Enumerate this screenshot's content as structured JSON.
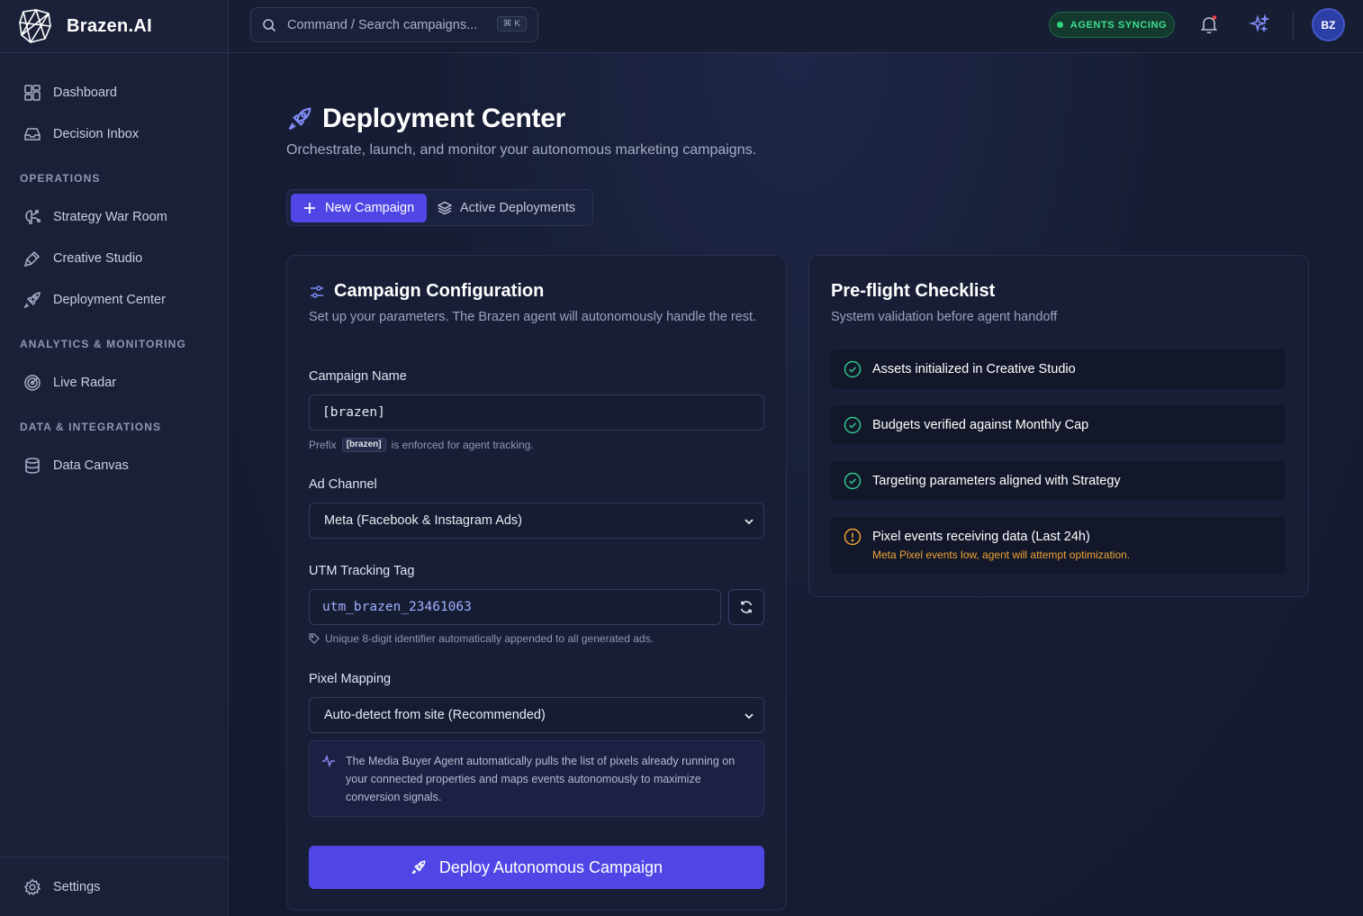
{
  "app": {
    "name": "Brazen.AI"
  },
  "sidebar": {
    "top_items": [
      {
        "label": "Dashboard",
        "icon": "dashboard-icon"
      },
      {
        "label": "Decision Inbox",
        "icon": "inbox-icon"
      }
    ],
    "sections": [
      {
        "title": "OPERATIONS",
        "items": [
          {
            "label": "Strategy War Room",
            "icon": "brain-icon"
          },
          {
            "label": "Creative Studio",
            "icon": "brush-icon"
          },
          {
            "label": "Deployment Center",
            "icon": "rocket-icon"
          }
        ]
      },
      {
        "title": "ANALYTICS & MONITORING",
        "items": [
          {
            "label": "Live Radar",
            "icon": "radar-icon"
          }
        ]
      },
      {
        "title": "DATA & INTEGRATIONS",
        "items": [
          {
            "label": "Data Canvas",
            "icon": "database-icon"
          }
        ]
      }
    ],
    "settings_label": "Settings"
  },
  "topbar": {
    "search_placeholder": "Command / Search campaigns...",
    "shortcut": "⌘ K",
    "status": "AGENTS SYNCING",
    "avatar_initials": "BZ"
  },
  "page": {
    "title": "Deployment Center",
    "subtitle": "Orchestrate, launch, and monitor your autonomous marketing campaigns.",
    "tabs": [
      {
        "label": "New Campaign",
        "active": true
      },
      {
        "label": "Active Deployments",
        "active": false
      }
    ]
  },
  "config": {
    "title": "Campaign Configuration",
    "subtitle": "Set up your parameters. The Brazen agent will autonomously handle the rest.",
    "campaign_name_label": "Campaign Name",
    "campaign_name_value": "[brazen]",
    "prefix_hint_pre": "Prefix",
    "prefix_chip": "[brazen]",
    "prefix_hint_post": "is enforced for agent tracking.",
    "ad_channel_label": "Ad Channel",
    "ad_channel_value": "Meta (Facebook & Instagram Ads)",
    "utm_label": "UTM Tracking Tag",
    "utm_value": "utm_brazen_23461063",
    "utm_hint": "Unique 8-digit identifier automatically appended to all generated ads.",
    "pixel_label": "Pixel Mapping",
    "pixel_value": "Auto-detect from site (Recommended)",
    "pixel_info": "The Media Buyer Agent automatically pulls the list of pixels already running on your connected properties and maps events autonomously to maximize conversion signals.",
    "deploy_label": "Deploy Autonomous Campaign"
  },
  "checklist": {
    "title": "Pre-flight Checklist",
    "subtitle": "System validation before agent handoff",
    "items": [
      {
        "text": "Assets initialized in Creative Studio",
        "status": "ok"
      },
      {
        "text": "Budgets verified against Monthly Cap",
        "status": "ok"
      },
      {
        "text": "Targeting parameters aligned with Strategy",
        "status": "ok"
      },
      {
        "text": "Pixel events receiving data (Last 24h)",
        "status": "warning",
        "note": "Meta Pixel events low, agent will attempt optimization."
      }
    ]
  },
  "colors": {
    "accent": "#5046e5",
    "success": "#31c48d",
    "warning": "#f0a534",
    "background": "#141a2e"
  }
}
